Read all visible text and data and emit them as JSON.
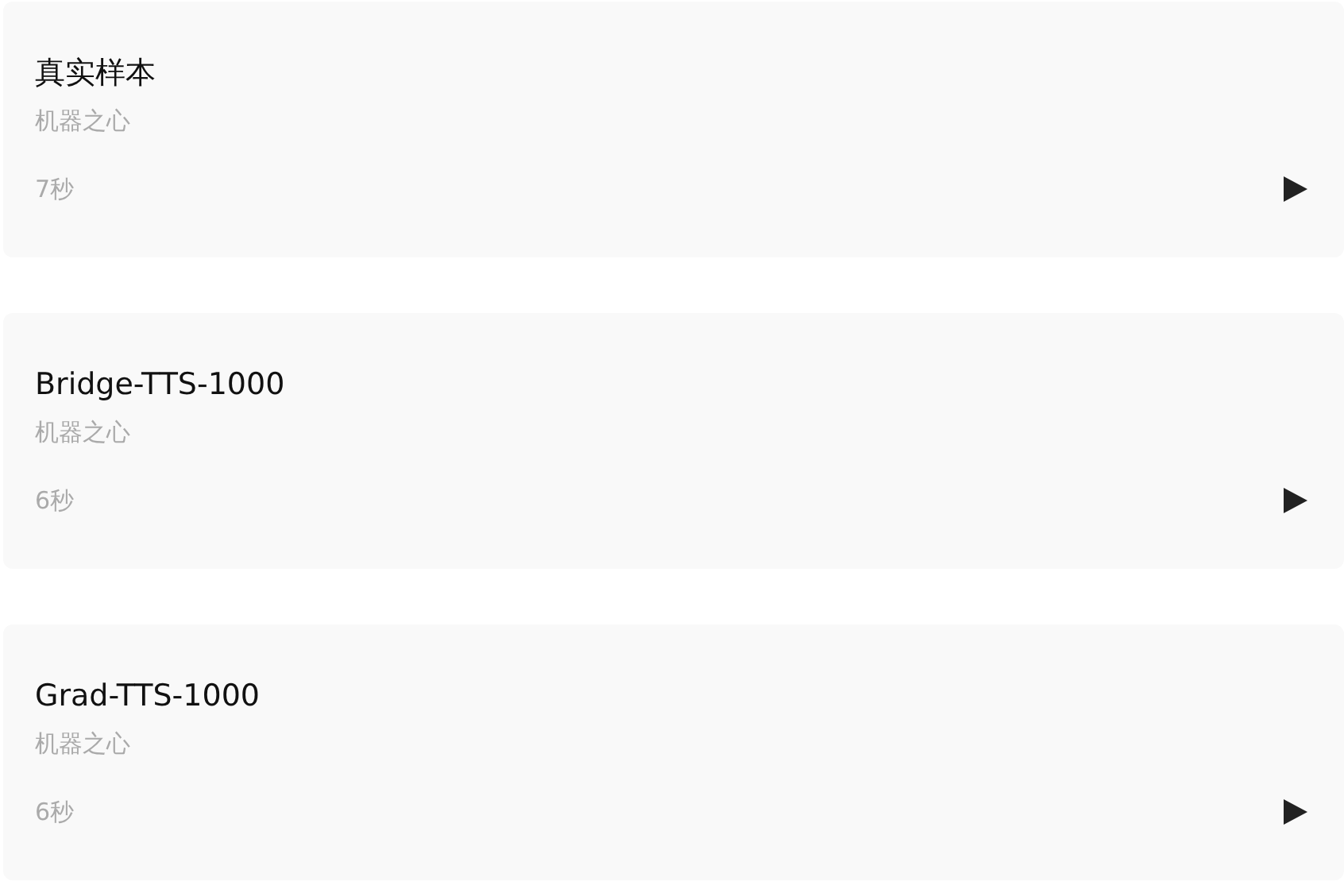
{
  "tracks": [
    {
      "title": "真实样本",
      "subtitle": "机器之心",
      "duration": "7秒"
    },
    {
      "title": "Bridge-TTS-1000",
      "subtitle": "机器之心",
      "duration": "6秒"
    },
    {
      "title": "Grad-TTS-1000",
      "subtitle": "机器之心",
      "duration": "6秒"
    }
  ]
}
